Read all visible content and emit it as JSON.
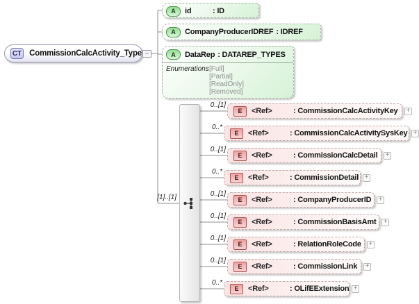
{
  "root": {
    "badge": "CT",
    "label": "CommissionCalcActivity_Type",
    "collapse_glyph": "−"
  },
  "sequence": {
    "cardinality": "[1]..[1]"
  },
  "attributes": [
    {
      "badge": "A",
      "name": "id",
      "type": ": ID"
    },
    {
      "badge": "A",
      "name": "CompanyProducerIDREF",
      "type": ": IDREF"
    },
    {
      "badge": "A",
      "name": "DataRep",
      "type": ": DATAREP_TYPES",
      "enumerations_label": "Enumerations",
      "enumerations": [
        "[Full]",
        "[Partial]",
        "[ReadOnly]",
        "[Removed]"
      ]
    }
  ],
  "elements": [
    {
      "badge": "E",
      "ref": "<Ref>",
      "type": ": CommissionCalcActivityKey",
      "cardinality": "0..[1]",
      "expand": "+"
    },
    {
      "badge": "E",
      "ref": "<Ref>",
      "type": ": CommissionCalcActivitySysKey",
      "cardinality": "0..*",
      "expand": "+"
    },
    {
      "badge": "E",
      "ref": "<Ref>",
      "type": ": CommissionCalcDetail",
      "cardinality": "0..[1]",
      "expand": "+"
    },
    {
      "badge": "E",
      "ref": "<Ref>",
      "type": ": CommissionDetail",
      "cardinality": "0..*",
      "expand": "+"
    },
    {
      "badge": "E",
      "ref": "<Ref>",
      "type": ": CompanyProducerID",
      "cardinality": "0..[1]",
      "expand": "+"
    },
    {
      "badge": "E",
      "ref": "<Ref>",
      "type": ": CommissionBasisAmt",
      "cardinality": "0..[1]",
      "expand": "+"
    },
    {
      "badge": "E",
      "ref": "<Ref>",
      "type": ": RelationRoleCode",
      "cardinality": "0..[1]",
      "expand": "+"
    },
    {
      "badge": "E",
      "ref": "<Ref>",
      "type": ": CommissionLink",
      "cardinality": "0..[1]",
      "expand": "+"
    },
    {
      "badge": "E",
      "ref": "<Ref>",
      "type": ": OLifEExtension",
      "cardinality": "0..*",
      "expand": "+"
    }
  ],
  "colors": {
    "attribute_green": "#d6f2d6",
    "element_pink": "#fae4e4",
    "complex_lavender": "#e3e3f2",
    "connector_gray": "#8f8f8f"
  }
}
